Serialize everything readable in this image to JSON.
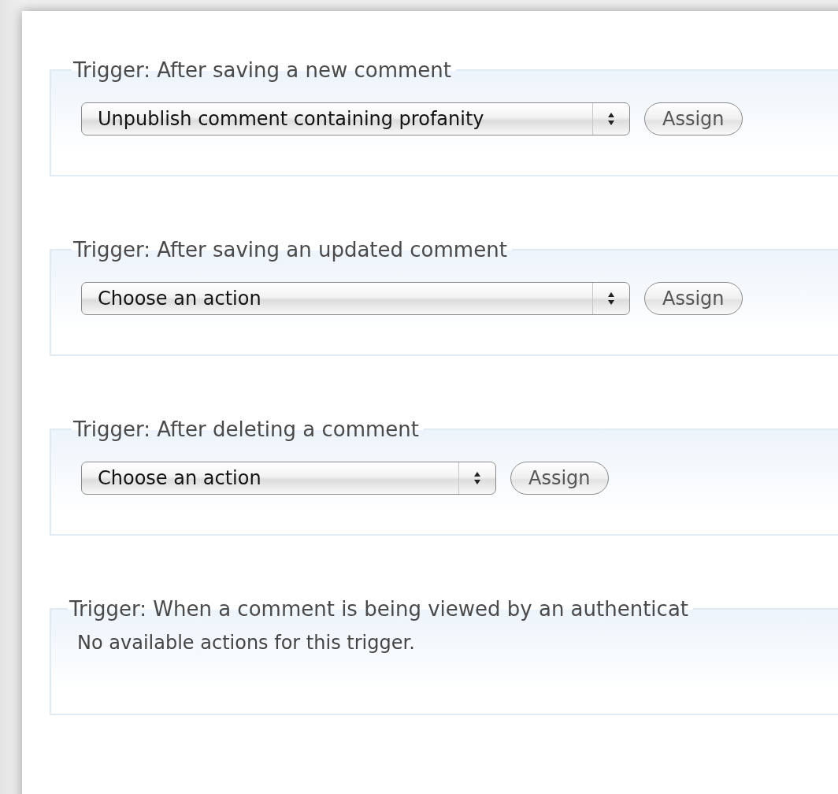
{
  "triggers": [
    {
      "legend": "Trigger: After saving a new comment",
      "kind": "select",
      "value": "Unpublish comment containing profanity",
      "button": "Assign"
    },
    {
      "legend": "Trigger: After saving an updated comment",
      "kind": "select",
      "value": "Choose an action",
      "button": "Assign"
    },
    {
      "legend": "Trigger: After deleting a comment",
      "kind": "select",
      "value": "Choose an action",
      "button": "Assign"
    },
    {
      "legend": "Trigger: When a comment is being viewed by an authenticat",
      "kind": "message",
      "message": "No available actions for this trigger."
    }
  ]
}
